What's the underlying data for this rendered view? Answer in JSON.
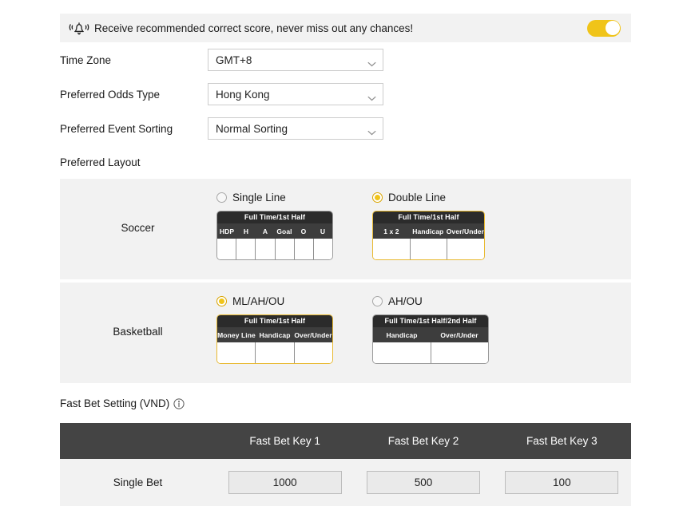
{
  "notice": {
    "icon": "bell-ring-icon",
    "text": "Receive recommended correct score, never miss out any chances!",
    "toggle_state": "on",
    "toggle_color": "#f0c419"
  },
  "settings": [
    {
      "label": "Time Zone",
      "value": "GMT+8",
      "icon": "chevron-down-icon"
    },
    {
      "label": "Preferred Odds Type",
      "value": "Hong Kong",
      "icon": "chevron-down-icon"
    },
    {
      "label": "Preferred Event Sorting",
      "value": "Normal Sorting",
      "icon": "chevron-down-icon"
    }
  ],
  "preferred_layout": {
    "title": "Preferred Layout",
    "sports": [
      {
        "name": "Soccer",
        "options": [
          {
            "label": "Single Line",
            "selected": false,
            "table": {
              "title": "Full Time/1st Half",
              "columns": [
                "HDP",
                "H",
                "A",
                "Goal",
                "O",
                "U"
              ]
            }
          },
          {
            "label": "Double Line",
            "selected": true,
            "table": {
              "title": "Full Time/1st Half",
              "columns": [
                "1 x 2",
                "Handicap",
                "Over/Under"
              ]
            }
          }
        ]
      },
      {
        "name": "Basketball",
        "options": [
          {
            "label": "ML/AH/OU",
            "selected": true,
            "table": {
              "title": "Full Time/1st Half",
              "columns": [
                "Money Line",
                "Handicap",
                "Over/Under"
              ]
            }
          },
          {
            "label": "AH/OU",
            "selected": false,
            "table": {
              "title": "Full Time/1st Half/2nd Half",
              "columns": [
                "Handicap",
                "Over/Under"
              ]
            }
          }
        ]
      }
    ]
  },
  "fast_bet": {
    "title": "Fast Bet Setting (VND)",
    "info_icon": "info-circle-icon",
    "columns": [
      "",
      "Fast Bet Key 1",
      "Fast Bet Key 2",
      "Fast Bet Key 3"
    ],
    "rows": [
      {
        "label": "Single Bet",
        "values": [
          "1000",
          "500",
          "100"
        ]
      }
    ]
  }
}
